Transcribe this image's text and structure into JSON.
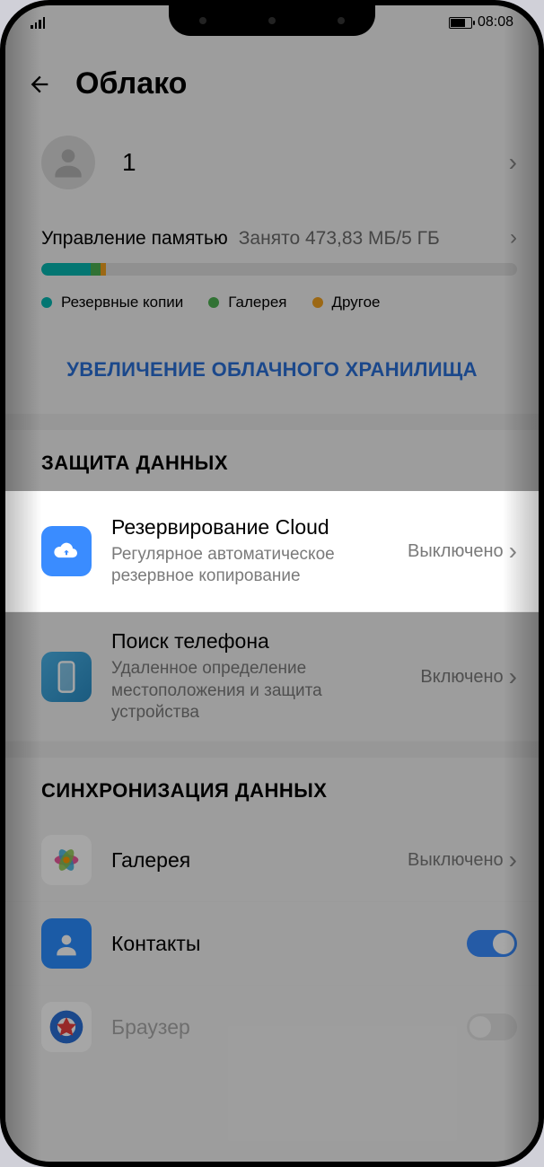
{
  "status": {
    "time": "08:08"
  },
  "header": {
    "title": "Облако"
  },
  "account": {
    "name": "1"
  },
  "storage": {
    "label": "Управление памятью",
    "value": "Занято 473,83 МБ/5 ГБ",
    "legend": {
      "backups": "Резервные копии",
      "gallery": "Галерея",
      "other": "Другое"
    }
  },
  "upsell": "УВЕЛИЧЕНИЕ ОБЛАЧНОГО ХРАНИЛИЩА",
  "sections": {
    "protection": {
      "title": "ЗАЩИТА ДАННЫХ",
      "cloud_backup": {
        "title": "Резервирование Cloud",
        "sub": "Регулярное автоматическое резервное копирование",
        "status": "Выключено"
      },
      "find_phone": {
        "title": "Поиск телефона",
        "sub": "Удаленное определение местоположения и защита устройства",
        "status": "Включено"
      }
    },
    "sync": {
      "title": "СИНХРОНИЗАЦИЯ ДАННЫХ",
      "gallery": {
        "title": "Галерея",
        "status": "Выключено"
      },
      "contacts": {
        "title": "Контакты"
      },
      "browser": {
        "title": "Браузер"
      }
    }
  }
}
